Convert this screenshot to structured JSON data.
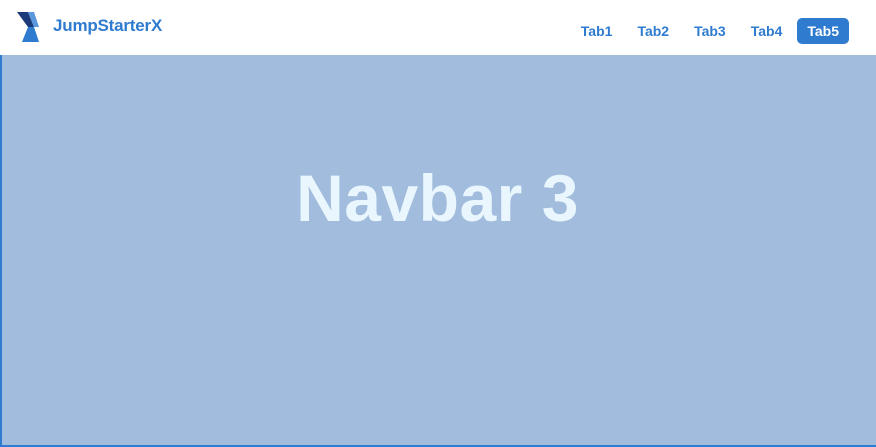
{
  "brand": {
    "logo_icon": "jumpstarterx-logo-icon",
    "name": "JumpStarterX"
  },
  "nav": {
    "tabs": [
      {
        "label": "Tab1",
        "active": false
      },
      {
        "label": "Tab2",
        "active": false
      },
      {
        "label": "Tab3",
        "active": false
      },
      {
        "label": "Tab4",
        "active": false
      },
      {
        "label": "Tab5",
        "active": true
      }
    ]
  },
  "hero": {
    "title": "Navbar 3"
  },
  "colors": {
    "accent": "#2e7bd0",
    "hero_background": "#a1bcdc",
    "hero_text": "#eaf6fd",
    "navbar_background": "#ffffff"
  }
}
